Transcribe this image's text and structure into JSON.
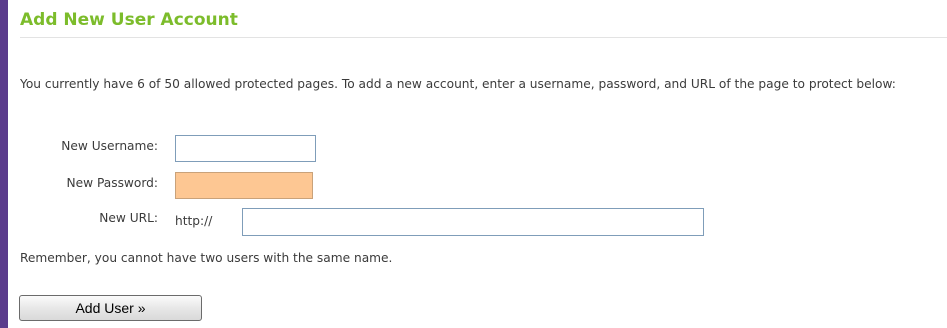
{
  "colors": {
    "frame_border": "#5b3c8c",
    "title_green": "#7cbc2b",
    "password_field_bg": "#fdc793"
  },
  "header": {
    "title": "Add New User Account"
  },
  "intro": {
    "text": "You currently have 6 of 50 allowed protected pages. To add a new account, enter a username, password, and URL of the page to protect below:"
  },
  "form": {
    "username_label": "New Username:",
    "username_value": "",
    "password_label": "New Password:",
    "password_value": "",
    "url_label": "New URL:",
    "url_prefix": "http://",
    "url_value": ""
  },
  "note": {
    "text": "Remember, you cannot have two users with the same name."
  },
  "actions": {
    "add_user_label": "Add User »"
  }
}
